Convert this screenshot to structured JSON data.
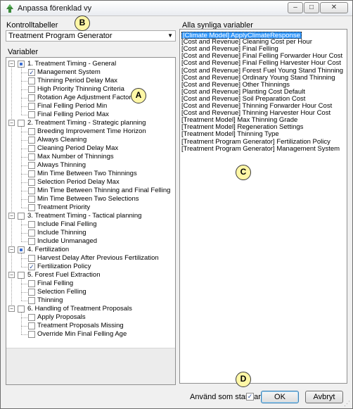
{
  "window": {
    "title": "Anpassa förenklad vy",
    "minimize": "–",
    "maximize": "□",
    "close": "✕"
  },
  "left": {
    "control_tables_label": "Kontrolltabeller",
    "control_table_selected": "Treatment Program Generator",
    "variables_label": "Variabler"
  },
  "right": {
    "all_visible_label": "Alla synliga variabler",
    "items": [
      "[Climate Model] ApplyClimateResponse",
      "[Cost and Revenue] Cleaning Cost per Hour",
      "[Cost and Revenue] Final Felling",
      "[Cost and Revenue] Final Felling Forwarder Hour Cost",
      "[Cost and Revenue] Final Felling Harvester Hour Cost",
      "[Cost and Revenue] Forest Fuel Young Stand Thinning",
      "[Cost and Revenue] Ordinary Young Stand Thinning",
      "[Cost and Revenue] Other Thinnings",
      "[Cost and Revenue] Planting Cost Default",
      "[Cost and Revenue] Soil Preparation Cost",
      "[Cost and Revenue] Thinning Forwarder Hour Cost",
      "[Cost and Revenue] Thinning Harvester Hour Cost",
      "[Treatment Model] Max Thinning Grade",
      "[Treatment Model] Regeneration Settings",
      "[Treatment Model] Thinning Type",
      "[Treatment Program Generator] Fertilization Policy",
      "[Treatment Program Generator] Management System"
    ]
  },
  "tree": {
    "groups": [
      {
        "label": "1. Treatment Timing - General",
        "state": "partial",
        "children": [
          {
            "label": "Management System",
            "checked": true
          },
          {
            "label": "Thinning Period Delay Max",
            "checked": false
          },
          {
            "label": "High Priority Thinning Criteria",
            "checked": false
          },
          {
            "label": "Rotation Age Adjustment Factor",
            "checked": false
          },
          {
            "label": "Final Felling Period Min",
            "checked": false
          },
          {
            "label": "Final Felling Period Max",
            "checked": false
          }
        ]
      },
      {
        "label": "2. Treatment Timing - Strategic planning",
        "state": "unchecked",
        "children": [
          {
            "label": "Breeding Improvement Time Horizon",
            "checked": false
          },
          {
            "label": "Always Cleaning",
            "checked": false
          },
          {
            "label": "Cleaning Period Delay Max",
            "checked": false
          },
          {
            "label": "Max Number of Thinnings",
            "checked": false
          },
          {
            "label": "Always Thinning",
            "checked": false
          },
          {
            "label": "Min Time Between Two Thinnings",
            "checked": false
          },
          {
            "label": "Selection Period Delay Max",
            "checked": false
          },
          {
            "label": "Min Time Between Thinning and Final Felling",
            "checked": false
          },
          {
            "label": "Min Time Between Two Selections",
            "checked": false
          },
          {
            "label": "Treatment Priority",
            "checked": false
          }
        ]
      },
      {
        "label": "3. Treatment Timing - Tactical planning",
        "state": "unchecked",
        "children": [
          {
            "label": "Include Final Felling",
            "checked": false
          },
          {
            "label": "Include Thinning",
            "checked": false
          },
          {
            "label": "Include Unmanaged",
            "checked": false
          }
        ]
      },
      {
        "label": "4. Fertilization",
        "state": "partial",
        "children": [
          {
            "label": "Harvest Delay After Previous Fertilization",
            "checked": false
          },
          {
            "label": "Fertilization Policy",
            "checked": true
          }
        ]
      },
      {
        "label": "5. Forest Fuel Extraction",
        "state": "unchecked",
        "children": [
          {
            "label": "Final Felling",
            "checked": false
          },
          {
            "label": "Selection Felling",
            "checked": false
          },
          {
            "label": "Thinning",
            "checked": false
          }
        ]
      },
      {
        "label": "6. Handling of Treatment Proposals",
        "state": "unchecked",
        "children": [
          {
            "label": "Apply Proposals",
            "checked": false
          },
          {
            "label": "Treatment Proposals Missing",
            "checked": false
          },
          {
            "label": "Override Min Final Felling Age",
            "checked": false
          }
        ]
      }
    ]
  },
  "footer": {
    "use_as_default_label": "Använd som standard",
    "use_as_default_checked": true,
    "ok_label": "OK",
    "cancel_label": "Avbryt"
  },
  "badges": {
    "a": "A",
    "b": "B",
    "c": "C",
    "d": "D"
  }
}
